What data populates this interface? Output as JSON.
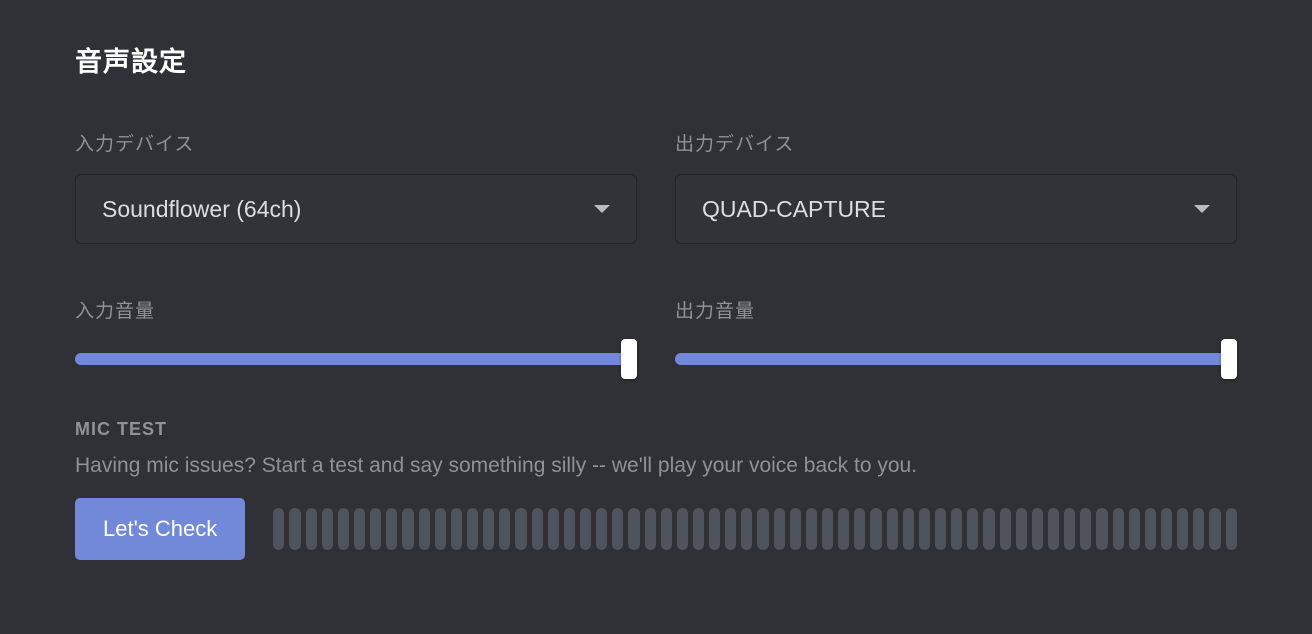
{
  "title": "音声設定",
  "input": {
    "device_label": "入力デバイス",
    "device_value": "Soundflower (64ch)",
    "volume_label": "入力音量",
    "volume_percent": 98
  },
  "output": {
    "device_label": "出力デバイス",
    "device_value": "QUAD-CAPTURE",
    "volume_label": "出力音量",
    "volume_percent": 98
  },
  "mic_test": {
    "title": "MIC TEST",
    "description": "Having mic issues? Start a test and say something silly -- we'll play your voice back to you.",
    "button_label": "Let's Check",
    "meter_bars": 60
  }
}
